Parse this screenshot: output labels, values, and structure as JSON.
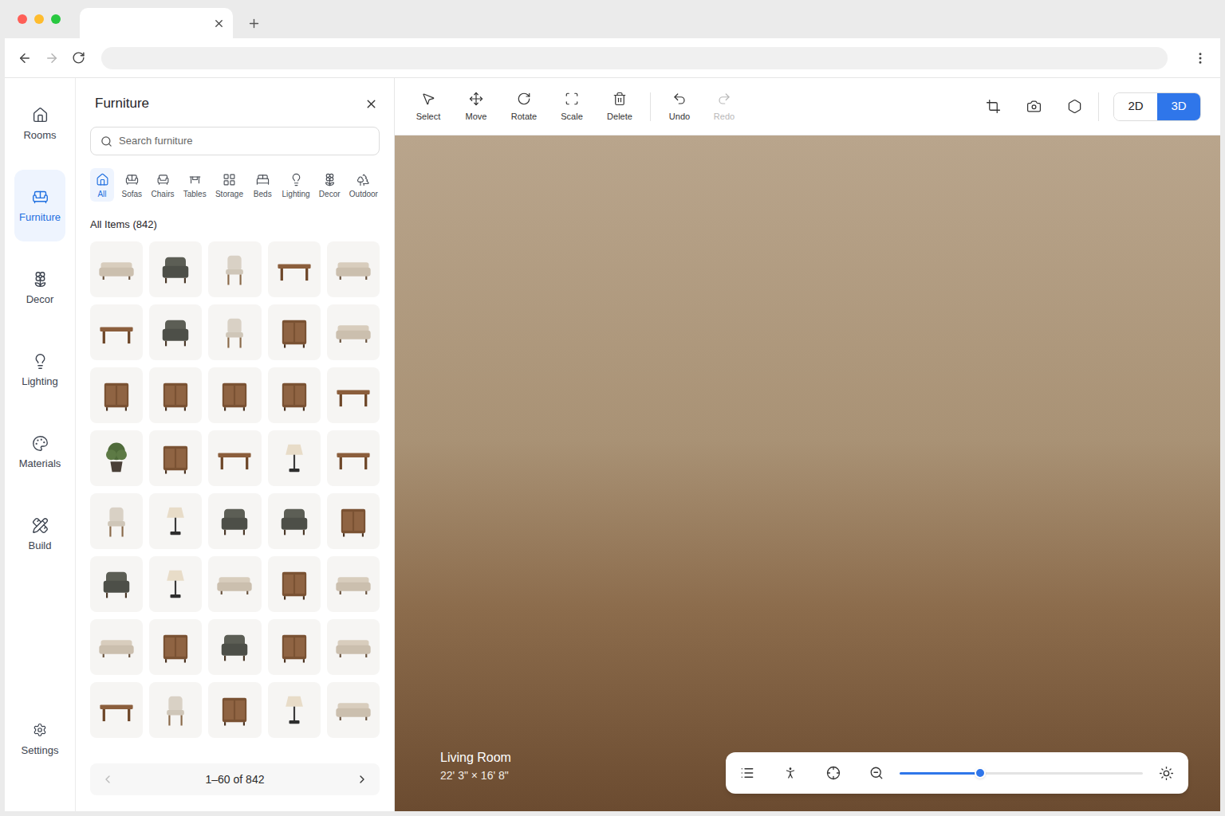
{
  "browser": {
    "back_disabled": false,
    "forward_disabled": true
  },
  "nav": [
    {
      "label": "Rooms",
      "selected": false
    },
    {
      "label": "Furniture",
      "selected": true
    },
    {
      "label": "Decor",
      "selected": false
    },
    {
      "label": "Lighting",
      "selected": false
    },
    {
      "label": "Materials",
      "selected": false
    },
    {
      "label": "Build",
      "selected": false
    }
  ],
  "nav_footer": {
    "label": "Settings",
    "selected": false
  },
  "panel": {
    "title": "Furniture",
    "search_placeholder": "Search furniture",
    "categories": [
      {
        "label": "All",
        "selected": true
      },
      {
        "label": "Sofas",
        "selected": false
      },
      {
        "label": "Chairs",
        "selected": false
      },
      {
        "label": "Tables",
        "selected": false
      },
      {
        "label": "Storage",
        "selected": false
      },
      {
        "label": "Beds",
        "selected": false
      },
      {
        "label": "Lighting",
        "selected": false
      },
      {
        "label": "Decor",
        "selected": false
      },
      {
        "label": "Outdoor",
        "selected": false
      }
    ],
    "section_title": "All Items (842)",
    "items": [
      {
        "kind": "sofa"
      },
      {
        "kind": "armchair"
      },
      {
        "kind": "chair"
      },
      {
        "kind": "table"
      },
      {
        "kind": "sofa"
      },
      {
        "kind": "table"
      },
      {
        "kind": "armchair"
      },
      {
        "kind": "chair"
      },
      {
        "kind": "storage"
      },
      {
        "kind": "sofa"
      },
      {
        "kind": "storage"
      },
      {
        "kind": "storage"
      },
      {
        "kind": "storage"
      },
      {
        "kind": "storage"
      },
      {
        "kind": "table"
      },
      {
        "kind": "plant"
      },
      {
        "kind": "storage"
      },
      {
        "kind": "table"
      },
      {
        "kind": "lamp"
      },
      {
        "kind": "table"
      },
      {
        "kind": "chair"
      },
      {
        "kind": "lamp"
      },
      {
        "kind": "armchair"
      },
      {
        "kind": "armchair"
      },
      {
        "kind": "storage"
      },
      {
        "kind": "armchair"
      },
      {
        "kind": "lamp"
      },
      {
        "kind": "sofa"
      },
      {
        "kind": "storage"
      },
      {
        "kind": "sofa"
      },
      {
        "kind": "sofa"
      },
      {
        "kind": "storage"
      },
      {
        "kind": "armchair"
      },
      {
        "kind": "storage"
      },
      {
        "kind": "sofa"
      },
      {
        "kind": "table"
      },
      {
        "kind": "chair"
      },
      {
        "kind": "storage"
      },
      {
        "kind": "lamp"
      },
      {
        "kind": "sofa"
      }
    ],
    "pagination": {
      "label": "1–60 of 842",
      "prev_disabled": true,
      "next_disabled": false
    }
  },
  "toolbar": {
    "tools": [
      {
        "label": "Select",
        "disabled": false
      },
      {
        "label": "Move",
        "disabled": false
      },
      {
        "label": "Rotate",
        "disabled": false
      },
      {
        "label": "Scale",
        "disabled": false
      },
      {
        "label": "Delete",
        "disabled": false
      }
    ],
    "history": [
      {
        "label": "Undo",
        "disabled": false
      },
      {
        "label": "Redo",
        "disabled": true
      }
    ],
    "view_modes": [
      {
        "label": "2D",
        "selected": false
      },
      {
        "label": "3D",
        "selected": true
      }
    ]
  },
  "viewport": {
    "room_name": "Living Room",
    "dimensions": "22' 3\" × 16' 8\"",
    "zoom": {
      "level": 0.33
    }
  }
}
